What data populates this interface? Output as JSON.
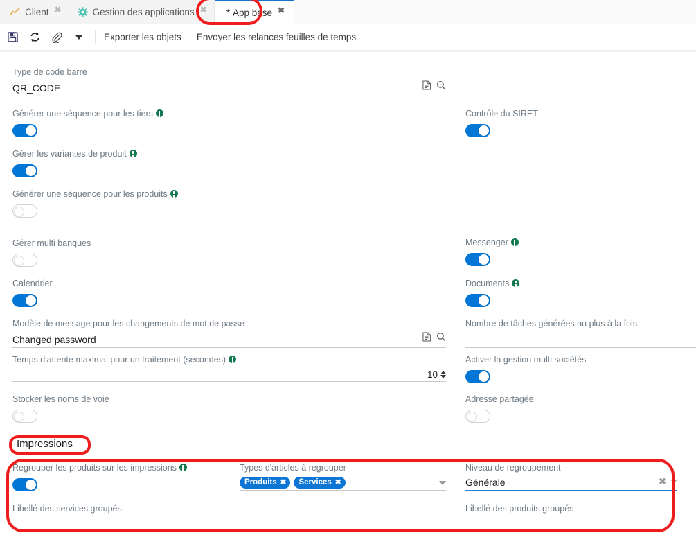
{
  "tabs": [
    {
      "label": "Client",
      "icon": "chart-line-icon",
      "active": false,
      "modified": false,
      "close": "✖"
    },
    {
      "label": "Gestion des applications",
      "icon": "gear-icon",
      "active": false,
      "modified": false,
      "close": "✖"
    },
    {
      "label": "App base",
      "icon": "",
      "active": true,
      "modified": true,
      "modified_mark": "*",
      "close": "✖"
    }
  ],
  "toolbar": {
    "icons": [
      {
        "name": "save-icon",
        "glyph": "💾"
      },
      {
        "name": "refresh-icon",
        "glyph": "⟳"
      },
      {
        "name": "attachment-icon",
        "glyph": "📎"
      }
    ],
    "dropdown_caret": "▾",
    "actions": [
      {
        "label": "Exporter les objets"
      },
      {
        "label": "Envoyer les relances feuilles de temps"
      }
    ]
  },
  "form": {
    "barcode": {
      "label": "Type de code barre",
      "value": "QR_CODE",
      "doc_icon": "document-icon",
      "search_icon": "search-icon"
    },
    "left_fields": [
      {
        "type": "switch",
        "label": "Générer une séquence pour les tiers",
        "info": true,
        "on": true
      },
      {
        "type": "switch",
        "label": "Gérer les variantes de produit",
        "info": true,
        "on": true
      },
      {
        "type": "switch",
        "label": "Générer une séquence pour les produits",
        "info": true,
        "on": false
      },
      {
        "type": "switch",
        "label": "Gérer multi banques",
        "info": false,
        "on": false
      },
      {
        "type": "switch",
        "label": "Calendrier",
        "info": false,
        "on": true
      }
    ],
    "password_template": {
      "label": "Modèle de message pour les changements de mot de passe",
      "value": "Changed password",
      "doc_icon": "document-icon",
      "search_icon": "search-icon"
    },
    "max_wait": {
      "label": "Temps d'attente maximal pour un traitement (secondes)",
      "info": true,
      "value": "10"
    },
    "store_street": {
      "type": "switch",
      "label": "Stocker les noms de voie",
      "info": false,
      "on": false
    },
    "right_fields": [
      {
        "type": "switch",
        "label": "Contrôle du SIRET",
        "info": false,
        "on": true
      },
      {
        "type": "switch",
        "label": "Messenger",
        "info": true,
        "on": true
      },
      {
        "type": "switch",
        "label": "Documents",
        "info": true,
        "on": true
      }
    ],
    "task_count": {
      "label": "Nombre de tâches générées au plus à la fois",
      "value": ""
    },
    "multi_company": {
      "type": "switch",
      "label": "Activer la gestion multi sociétés",
      "info": false,
      "on": true
    },
    "shared_address": {
      "type": "switch",
      "label": "Adresse partagée",
      "info": false,
      "on": false
    }
  },
  "impressions": {
    "title": "Impressions",
    "group_products": {
      "label": "Regrouper les produits sur les impressions",
      "info": true,
      "on": true
    },
    "article_types": {
      "label": "Types d'articles à regrouper",
      "chips": [
        {
          "label": "Produits",
          "remove": "✖"
        },
        {
          "label": "Services",
          "remove": "✖"
        }
      ],
      "caret": "▾"
    },
    "grouping_level": {
      "label": "Niveau de regroupement",
      "value": "Générale",
      "focused": true,
      "clear": "✖",
      "caret": "▾"
    },
    "grouped_services_label": {
      "label": "Libellé des services groupés",
      "value": ""
    },
    "grouped_products_label": {
      "label": "Libellé des produits groupés",
      "value": ""
    }
  },
  "annotations": {
    "color": "#ee1c1c",
    "regions": [
      {
        "name": "app-base-tab-highlight"
      },
      {
        "name": "impressions-title-highlight"
      },
      {
        "name": "impressions-section-highlight"
      }
    ]
  }
}
